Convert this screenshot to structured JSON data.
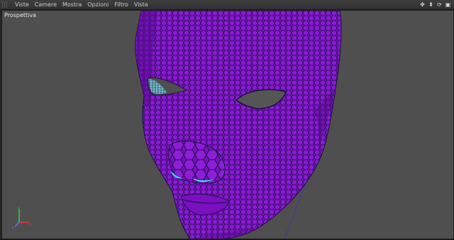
{
  "menu": {
    "items": [
      "Viste",
      "Camere",
      "Mostra",
      "Opzioni",
      "Filtro",
      "Vista"
    ]
  },
  "nav_icons": [
    "move-view-icon",
    "dolly-view-icon",
    "rotate-view-icon",
    "maximize-view-icon"
  ],
  "viewport": {
    "label": "Prospettiva"
  },
  "colors": {
    "viewport_bg": "#4f4f4f",
    "mesh": "#7a0fc0",
    "wire": "#1a1040",
    "highlight": "#35e0e6"
  }
}
